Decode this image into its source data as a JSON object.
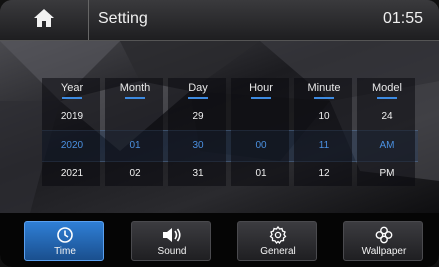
{
  "header": {
    "title": "Setting",
    "time": "01:55"
  },
  "picker": {
    "columns": [
      {
        "label": "Year",
        "prev": "2019",
        "selected": "2020",
        "next": "2021"
      },
      {
        "label": "Month",
        "prev": "",
        "selected": "01",
        "next": "02"
      },
      {
        "label": "Day",
        "prev": "29",
        "selected": "30",
        "next": "31"
      },
      {
        "label": "Hour",
        "prev": "",
        "selected": "00",
        "next": "01"
      },
      {
        "label": "Minute",
        "prev": "10",
        "selected": "11",
        "next": "12"
      },
      {
        "label": "Model",
        "prev": "24",
        "selected": "AM",
        "next": "PM"
      }
    ]
  },
  "nav": {
    "items": [
      {
        "label": "Time",
        "icon": "clock-icon",
        "active": true
      },
      {
        "label": "Sound",
        "icon": "speaker-icon",
        "active": false
      },
      {
        "label": "General",
        "icon": "gear-icon",
        "active": false
      },
      {
        "label": "Wallpaper",
        "icon": "flower-icon",
        "active": false
      }
    ]
  },
  "colors": {
    "accent": "#3d8ae0",
    "active_tab": "#2f7fd6"
  }
}
